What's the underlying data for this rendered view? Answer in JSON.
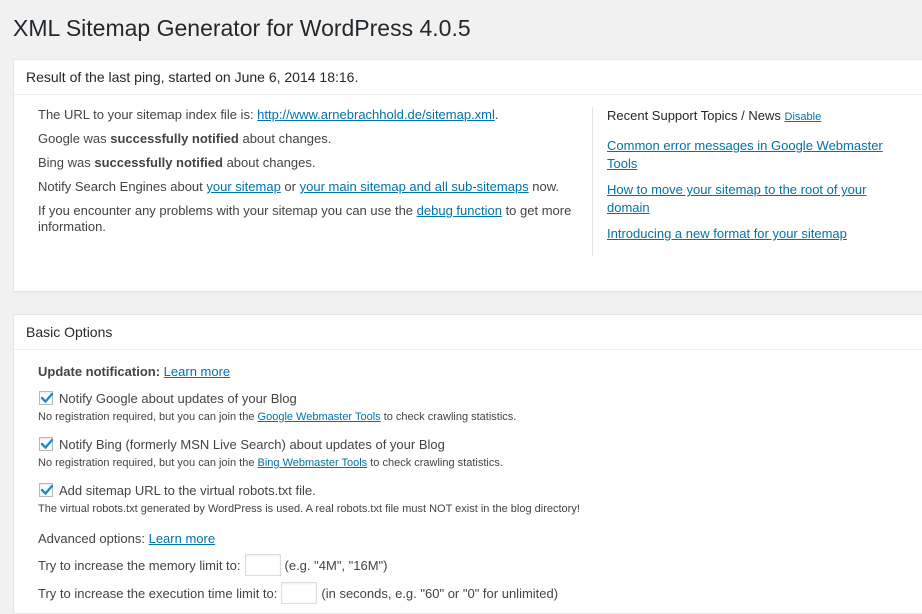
{
  "page": {
    "title": "XML Sitemap Generator for WordPress 4.0.5"
  },
  "ping_box": {
    "title": "Result of the last ping, started on June 6, 2014 18:16.",
    "line1_prefix": "The URL to your sitemap index file is: ",
    "sitemap_url": "http://www.arnebrachhold.de/sitemap.xml",
    "line1_suffix": ".",
    "google_prefix": "Google was ",
    "google_bold": "successfully notified",
    "google_suffix": " about changes.",
    "bing_prefix": "Bing was ",
    "bing_bold": "successfully notified",
    "bing_suffix": " about changes.",
    "notify_prefix": "Notify Search Engines about ",
    "notify_link1": "your sitemap",
    "notify_mid": " or ",
    "notify_link2": "your main sitemap and all sub-sitemaps",
    "notify_suffix": " now.",
    "problem_prefix": "If you encounter any problems with your sitemap you can use the ",
    "problem_link": "debug function",
    "problem_suffix": " to get more information."
  },
  "news": {
    "title": "Recent Support Topics / News",
    "disable_label": "Disable",
    "items": [
      "Common error messages in Google Webmaster Tools",
      "How to move your sitemap to the root of your domain",
      "Introducing a new format for your sitemap"
    ]
  },
  "basic_box": {
    "title": "Basic Options",
    "update_label": "Update notification:",
    "learn_more": "Learn more",
    "google_cb_label": "Notify Google about updates of your Blog",
    "google_note_prefix": "No registration required, but you can join the ",
    "google_note_link": "Google Webmaster Tools",
    "google_note_suffix": " to check crawling statistics.",
    "bing_cb_label": "Notify Bing (formerly MSN Live Search) about updates of your Blog",
    "bing_note_prefix": "No registration required, but you can join the ",
    "bing_note_link": "Bing Webmaster Tools",
    "bing_note_suffix": " to check crawling statistics.",
    "robots_cb_label": "Add sitemap URL to the virtual robots.txt file.",
    "robots_note": "The virtual robots.txt generated by WordPress is used. A real robots.txt file must NOT exist in the blog directory!",
    "advanced_label": "Advanced options:",
    "advanced_learn_more": "Learn more",
    "memory_label": "Try to increase the memory limit to:",
    "memory_value": "",
    "memory_hint": "(e.g. \"4M\", \"16M\")",
    "exec_label": "Try to increase the execution time limit to:",
    "exec_value": "",
    "exec_hint": "(in seconds, e.g. \"60\" or \"0\" for unlimited)"
  },
  "colors": {
    "link": "#0073aa",
    "checkmark": "#1e8cbe",
    "background": "#f1f1f1"
  }
}
